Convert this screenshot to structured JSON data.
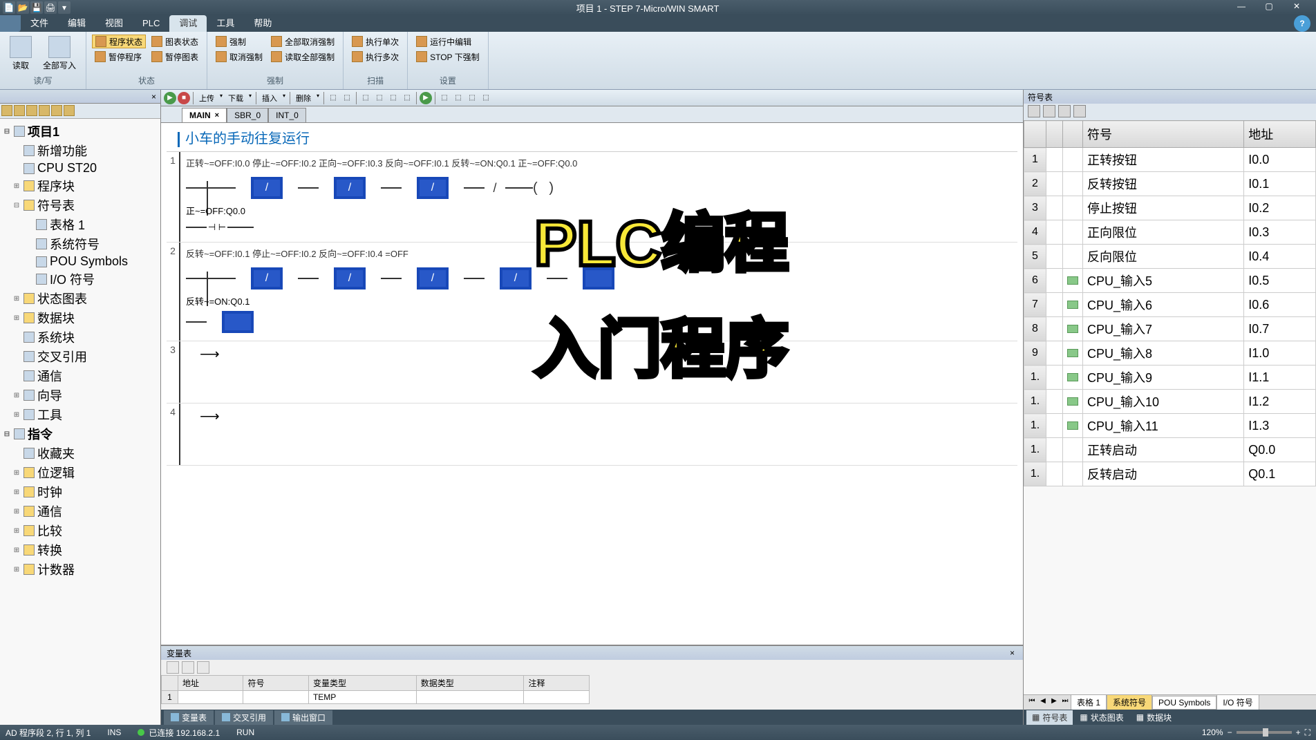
{
  "title": "项目 1 - STEP 7-Micro/WIN SMART",
  "ribbon": {
    "tabs": [
      "文件",
      "编辑",
      "视图",
      "PLC",
      "调试",
      "工具",
      "帮助"
    ],
    "active_tab": "调试",
    "groups": {
      "rw": {
        "label": "读/写",
        "read": "读取",
        "write_all": "全部写入"
      },
      "status": {
        "label": "状态",
        "prog_status": "程序状态",
        "pause_prog": "暂停程序",
        "chart_status": "图表状态",
        "pause_chart": "暂停图表"
      },
      "force": {
        "label": "强制",
        "force": "强制",
        "cancel_force": "取消强制",
        "unforce_all": "全部取消强制",
        "read_all_force": "读取全部强制"
      },
      "scan": {
        "label": "扫描",
        "exec_once": "执行单次",
        "exec_multi": "执行多次"
      },
      "settings": {
        "label": "设置",
        "run_edit": "运行中编辑",
        "stop_force": "STOP 下强制"
      }
    }
  },
  "tree": [
    {
      "l": 0,
      "t": "项目1",
      "e": "-"
    },
    {
      "l": 1,
      "t": "新增功能",
      "i": "star"
    },
    {
      "l": 1,
      "t": "CPU ST20",
      "i": "cpu"
    },
    {
      "l": 1,
      "t": "程序块",
      "e": "+",
      "i": "folder"
    },
    {
      "l": 1,
      "t": "符号表",
      "e": "-",
      "i": "folder"
    },
    {
      "l": 2,
      "t": "表格 1",
      "i": "table"
    },
    {
      "l": 2,
      "t": "系统符号",
      "i": "table"
    },
    {
      "l": 2,
      "t": "POU Symbols",
      "i": "table"
    },
    {
      "l": 2,
      "t": "I/O 符号",
      "i": "table"
    },
    {
      "l": 1,
      "t": "状态图表",
      "e": "+",
      "i": "folder"
    },
    {
      "l": 1,
      "t": "数据块",
      "e": "+",
      "i": "folder"
    },
    {
      "l": 1,
      "t": "系统块",
      "i": "block"
    },
    {
      "l": 1,
      "t": "交叉引用",
      "i": "ref"
    },
    {
      "l": 1,
      "t": "通信",
      "i": "comm"
    },
    {
      "l": 1,
      "t": "向导",
      "e": "+",
      "i": "wiz"
    },
    {
      "l": 1,
      "t": "工具",
      "e": "+",
      "i": "tool"
    },
    {
      "l": 0,
      "t": "指令",
      "e": "-"
    },
    {
      "l": 1,
      "t": "收藏夹",
      "i": "fav"
    },
    {
      "l": 1,
      "t": "位逻辑",
      "e": "+",
      "i": "folder"
    },
    {
      "l": 1,
      "t": "时钟",
      "e": "+",
      "i": "folder"
    },
    {
      "l": 1,
      "t": "通信",
      "e": "+",
      "i": "folder"
    },
    {
      "l": 1,
      "t": "比较",
      "e": "+",
      "i": "folder"
    },
    {
      "l": 1,
      "t": "转换",
      "e": "+",
      "i": "folder"
    },
    {
      "l": 1,
      "t": "计数器",
      "e": "+",
      "i": "folder"
    }
  ],
  "editor": {
    "toolbar_dd": {
      "upload": "上传",
      "download": "下载",
      "insert": "插入",
      "delete": "删除"
    },
    "tabs": [
      {
        "label": "MAIN",
        "active": true,
        "closable": true
      },
      {
        "label": "SBR_0",
        "active": false
      },
      {
        "label": "INT_0",
        "active": false
      }
    ],
    "program_title": "小车的手动往复运行",
    "net1_comment": "正转~=OFF:I0.0  停止~=OFF:I0.2  正向~=OFF:I0.3  反向~=OFF:I0.1  反转~=ON:Q0.1  正~=OFF:Q0.0",
    "net1_line2": "正~=OFF:Q0.0",
    "net2_comment": "反转~=OFF:I0.1  停止~=OFF:I0.2  反向~=OFF:I0.4         =OFF",
    "net2_line2": "反转~=ON:Q0.1"
  },
  "overlay": {
    "line1": "PLC编程",
    "line2": "入门程序"
  },
  "var_panel": {
    "title": "变量表",
    "headers": [
      "地址",
      "符号",
      "变量类型",
      "数据类型",
      "注释"
    ],
    "rows": [
      [
        "",
        "",
        "TEMP",
        "",
        ""
      ]
    ],
    "bottom_tabs": [
      "变量表",
      "交叉引用",
      "输出窗口"
    ]
  },
  "right_panel": {
    "title": "符号表",
    "headers": {
      "sym": "符号",
      "addr": "地址"
    },
    "rows": [
      {
        "n": "1",
        "ico": false,
        "sym": "正转按钮",
        "addr": "I0.0"
      },
      {
        "n": "2",
        "ico": false,
        "sym": "反转按钮",
        "addr": "I0.1"
      },
      {
        "n": "3",
        "ico": false,
        "sym": "停止按钮",
        "addr": "I0.2"
      },
      {
        "n": "4",
        "ico": false,
        "sym": "正向限位",
        "addr": "I0.3"
      },
      {
        "n": "5",
        "ico": false,
        "sym": "反向限位",
        "addr": "I0.4"
      },
      {
        "n": "6",
        "ico": true,
        "sym": "CPU_输入5",
        "addr": "I0.5"
      },
      {
        "n": "7",
        "ico": true,
        "sym": "CPU_输入6",
        "addr": "I0.6"
      },
      {
        "n": "8",
        "ico": true,
        "sym": "CPU_输入7",
        "addr": "I0.7"
      },
      {
        "n": "9",
        "ico": true,
        "sym": "CPU_输入8",
        "addr": "I1.0"
      },
      {
        "n": "1.",
        "ico": true,
        "sym": "CPU_输入9",
        "addr": "I1.1"
      },
      {
        "n": "1.",
        "ico": true,
        "sym": "CPU_输入10",
        "addr": "I1.2"
      },
      {
        "n": "1.",
        "ico": true,
        "sym": "CPU_输入11",
        "addr": "I1.3"
      },
      {
        "n": "1.",
        "ico": false,
        "sym": "正转启动",
        "addr": "Q0.0"
      },
      {
        "n": "1.",
        "ico": false,
        "sym": "反转启动",
        "addr": "Q0.1"
      }
    ],
    "tabs": [
      "表格 1",
      "系统符号",
      "POU Symbols",
      "I/O 符号"
    ],
    "active_tab": "系统符号",
    "bottom_tabs": [
      "符号表",
      "状态图表",
      "数据块"
    ]
  },
  "status": {
    "left": "AD 程序段 2, 行 1, 列 1",
    "ins": "INS",
    "conn": "已连接 192.168.2.1",
    "run": "RUN",
    "zoom": "120%"
  }
}
